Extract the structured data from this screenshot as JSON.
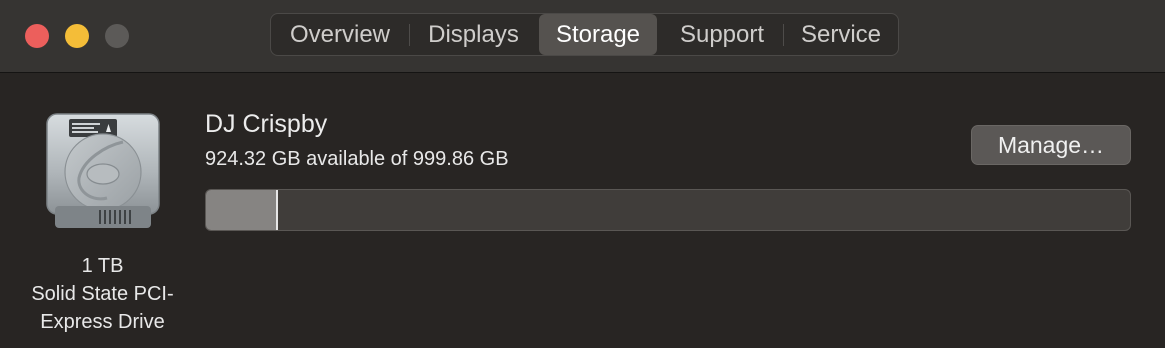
{
  "window": {
    "tabs": [
      {
        "label": "Overview"
      },
      {
        "label": "Displays"
      },
      {
        "label": "Storage"
      },
      {
        "label": "Support"
      },
      {
        "label": "Service"
      }
    ],
    "active_tab": "Storage"
  },
  "drive": {
    "caption_capacity": "1 TB",
    "caption_type_line1": "Solid State PCI-",
    "caption_type_line2": "Express Drive",
    "name": "DJ Crispby",
    "availability": "924.32 GB available of 999.86 GB",
    "used_fraction": 0.0755,
    "manage_label": "Manage…"
  },
  "colors": {
    "background": "#282523",
    "titlebar": "#363432",
    "close": "#ec5f5c",
    "minimize": "#f4bd38",
    "zoom_disabled": "#5c5a58",
    "bar_used": "#868482"
  },
  "icons": {
    "drive": "internal-ssd-icon"
  }
}
